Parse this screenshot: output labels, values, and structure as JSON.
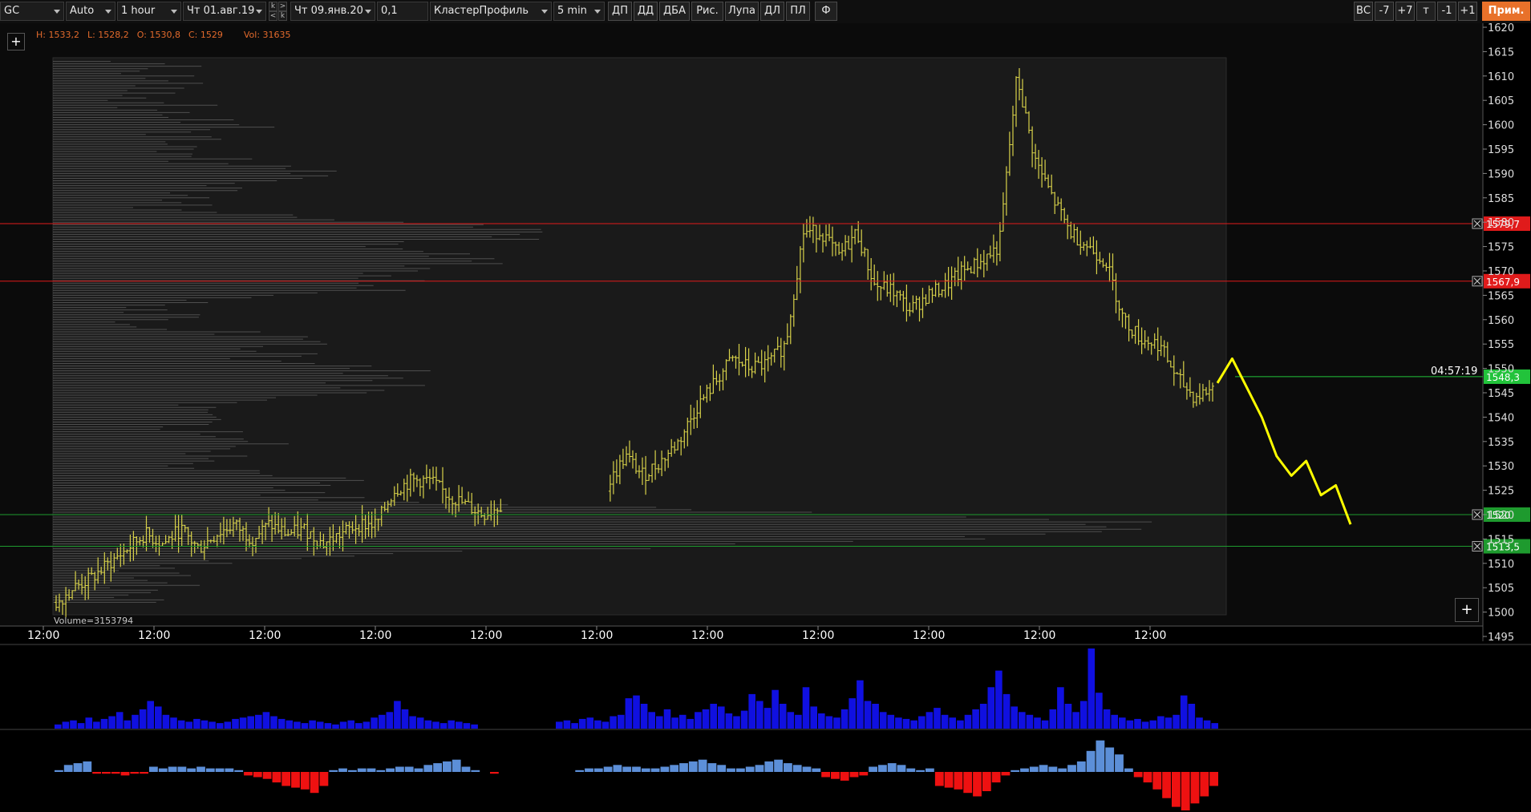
{
  "toolbar": {
    "symbol": "GC",
    "scale": "Auto",
    "interval": "1 hour",
    "date_from": "Чт 01.авг.19",
    "date_to": "Чт 09.янв.20",
    "step": "0,1",
    "template": "КластерПрофиль",
    "cluster_tf": "5 min",
    "buttons": [
      "ДП",
      "ДД",
      "ДБА",
      "Рис.",
      "Лупа",
      "ДЛ",
      "ПЛ",
      "Ф"
    ],
    "right_buttons": [
      "ВС",
      "-7",
      "+7",
      "т",
      "-1",
      "+1"
    ],
    "apply_label": "Прим.",
    "k_labels": [
      "k",
      ">",
      "<",
      "k"
    ]
  },
  "info": {
    "high": "H: 1533,2",
    "low": "L: 1528,2",
    "open": "O: 1530,8",
    "close": "C: 1529",
    "volume": "Vol: 31635"
  },
  "volume_total": "Volume=3153794",
  "timer": "04:57:19",
  "price_axis": {
    "ticks": [
      "1620",
      "1615",
      "1610",
      "1605",
      "1600",
      "1595",
      "1590",
      "1585",
      "1580",
      "1575",
      "1570",
      "1565",
      "1560",
      "1555",
      "1550",
      "1545",
      "1540",
      "1535",
      "1530",
      "1525",
      "1520",
      "1515",
      "1510",
      "1505",
      "1500",
      "1495"
    ]
  },
  "time_axis": {
    "labels": [
      "12:00",
      "12:00",
      "12:00",
      "12:00",
      "12:00",
      "12:00",
      "12:00",
      "12:00",
      "12:00",
      "12:00",
      "12:00"
    ]
  },
  "levels": [
    {
      "label": "1579,7",
      "value": 1579.7,
      "color": "#e01b1b"
    },
    {
      "label": "1567,9",
      "value": 1567.9,
      "color": "#e01b1b"
    },
    {
      "label": "1548,3",
      "value": 1548.3,
      "color": "#22c33b"
    },
    {
      "label": "1520",
      "value": 1520,
      "color": "#1e9a2e"
    },
    {
      "label": "1513,5",
      "value": 1513.5,
      "color": "#1e9a2e"
    }
  ],
  "colors": {
    "price_bars": "#d8d24a",
    "forecast": "#ffff00",
    "volume": "#1010e0",
    "delta_positive": "#5c8fd8",
    "delta_negative": "#ee1111",
    "profile": "#7a7a7a"
  },
  "chart_data": {
    "type": "bar",
    "y_axis_range": [
      1495,
      1620
    ],
    "price_path": [
      1502,
      1505,
      1507,
      1510,
      1513,
      1516,
      1514,
      1517,
      1513,
      1516,
      1518,
      1515,
      1518,
      1516,
      1517,
      1514,
      1516,
      1518,
      1518,
      1525,
      1527,
      1527,
      1524,
      1522,
      1520,
      1522,
      1521,
      1520,
      1522,
      1521,
      1523,
      1526,
      1532,
      1528,
      1531,
      1535,
      1542,
      1547,
      1552,
      1550,
      1551,
      1555,
      1578,
      1578,
      1573,
      1578,
      1567,
      1566,
      1562,
      1565,
      1567,
      1570,
      1572,
      1575,
      1610,
      1593,
      1585,
      1578,
      1575,
      1572,
      1560,
      1556,
      1555,
      1548,
      1544,
      1546
    ],
    "forecast_path": [
      1547,
      1552,
      1546,
      1540,
      1532,
      1528,
      1531,
      1524,
      1526,
      1518
    ],
    "volume_bars": [
      3,
      5,
      6,
      4,
      8,
      5,
      7,
      9,
      12,
      6,
      10,
      14,
      20,
      16,
      10,
      8,
      6,
      5,
      7,
      6,
      5,
      4,
      5,
      7,
      8,
      9,
      10,
      12,
      9,
      7,
      6,
      5,
      4,
      6,
      5,
      4,
      3,
      5,
      6,
      4,
      5,
      8,
      10,
      12,
      20,
      14,
      9,
      8,
      6,
      5,
      4,
      6,
      5,
      4,
      3,
      0,
      0,
      0,
      0,
      0,
      0,
      0,
      0,
      0,
      0,
      5,
      6,
      4,
      7,
      8,
      6,
      5,
      9,
      10,
      22,
      24,
      18,
      12,
      9,
      14,
      8,
      10,
      7,
      12,
      14,
      18,
      16,
      11,
      9,
      13,
      25,
      20,
      15,
      28,
      18,
      12,
      10,
      30,
      16,
      11,
      9,
      8,
      14,
      22,
      35,
      20,
      18,
      12,
      10,
      8,
      7,
      6,
      9,
      12,
      15,
      10,
      8,
      6,
      10,
      14,
      18,
      30,
      42,
      25,
      16,
      12,
      10,
      8,
      6,
      14,
      30,
      18,
      12,
      20,
      58,
      26,
      14,
      10,
      8,
      6,
      7,
      5,
      6,
      9,
      8,
      10,
      24,
      18,
      8,
      6,
      4
    ],
    "delta_bars": [
      1,
      4,
      5,
      6,
      -1,
      -1,
      -1,
      -2,
      -1,
      -1,
      3,
      2,
      3,
      3,
      2,
      3,
      2,
      2,
      2,
      1,
      -2,
      -3,
      -4,
      -6,
      -8,
      -9,
      -10,
      -12,
      -8,
      1,
      2,
      1,
      2,
      2,
      1,
      2,
      3,
      3,
      2,
      4,
      5,
      6,
      7,
      3,
      1,
      0,
      -1,
      0,
      0,
      0,
      0,
      0,
      0,
      0,
      0,
      1,
      2,
      2,
      3,
      4,
      3,
      3,
      2,
      2,
      3,
      4,
      5,
      6,
      7,
      5,
      4,
      2,
      2,
      3,
      4,
      6,
      7,
      5,
      4,
      3,
      2,
      -3,
      -4,
      -5,
      -3,
      -2,
      3,
      4,
      5,
      4,
      2,
      1,
      2,
      -8,
      -9,
      -10,
      -12,
      -14,
      -11,
      -6,
      -2,
      1,
      2,
      3,
      4,
      3,
      2,
      4,
      6,
      12,
      18,
      14,
      10,
      2,
      -3,
      -6,
      -10,
      -15,
      -20,
      -22,
      -18,
      -14,
      -8
    ]
  }
}
